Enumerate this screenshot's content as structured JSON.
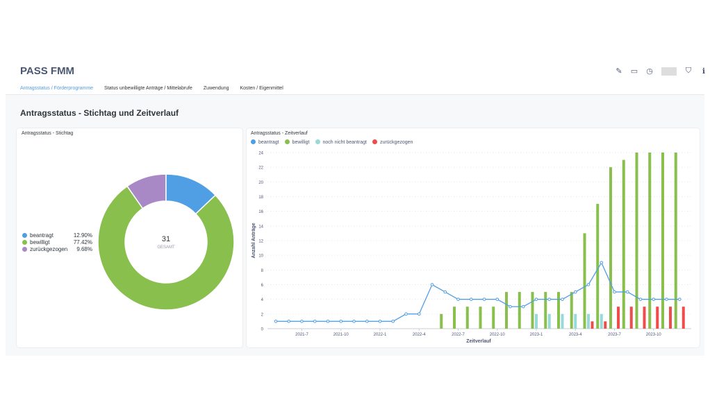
{
  "header": {
    "title": "PASS FMM",
    "icons": [
      "pencil-icon",
      "archive-icon",
      "clock-icon",
      "bookmark-icon",
      "info-icon",
      "more-icon"
    ]
  },
  "tabs": [
    {
      "label": "Antragsstatus / Förderprogramme",
      "active": true
    },
    {
      "label": "Status unbewilligte Anträge / Mittelabrufe"
    },
    {
      "label": "Zuwendung"
    },
    {
      "label": "Kosten / Eigenmittel"
    }
  ],
  "section_title": "Antragsstatus - Stichtag und Zeitverlauf",
  "colors": {
    "beantragt": "#509ee3",
    "bewilligt": "#88bf4d",
    "noch nicht beantragt": "#98d9d9",
    "zurückgezogen": "#ef4c4c",
    "zurückgezogen_pie": "#a989c5"
  },
  "chart_data": [
    {
      "type": "pie",
      "title": "Antragsstatus - Stichtag",
      "center_value": "31",
      "center_label": "GESAMT",
      "slices": [
        {
          "name": "beantragt",
          "percent": "12.90%",
          "value": 12.9
        },
        {
          "name": "bewilligt",
          "percent": "77.42%",
          "value": 77.42
        },
        {
          "name": "zurückgezogen",
          "percent": "9.68%",
          "value": 9.68
        }
      ]
    },
    {
      "type": "bar",
      "title": "Antragsstatus - Zeitverlauf",
      "xlabel": "Zeitverlauf",
      "ylabel": "Anzahl Anträge",
      "ylim": [
        0,
        24
      ],
      "yticks": [
        "0",
        "2",
        "4",
        "6",
        "8",
        "10",
        "12",
        "14",
        "16",
        "18",
        "20",
        "22",
        "24"
      ],
      "xticks": [
        "2021-7",
        "2021-10",
        "2022-1",
        "2022-4",
        "2022-7",
        "2022-10",
        "2023-1",
        "2023-4",
        "2023-7",
        "2023-10"
      ],
      "x": [
        "2021-5",
        "2021-6",
        "2021-7",
        "2021-8",
        "2021-9",
        "2021-10",
        "2021-11",
        "2021-12",
        "2022-1",
        "2022-2",
        "2022-3",
        "2022-4",
        "2022-5",
        "2022-6",
        "2022-7",
        "2022-8",
        "2022-9",
        "2022-10",
        "2022-11",
        "2022-12",
        "2023-1",
        "2023-2",
        "2023-3",
        "2023-4",
        "2023-5",
        "2023-6",
        "2023-7",
        "2023-8",
        "2023-9",
        "2023-10",
        "2023-11",
        "2023-12"
      ],
      "series": [
        {
          "name": "beantragt",
          "type": "line",
          "values": [
            1,
            1,
            1,
            1,
            1,
            1,
            1,
            1,
            1,
            1,
            2,
            2,
            6,
            5,
            4,
            4,
            4,
            4,
            3,
            3,
            4,
            4,
            4,
            5,
            6,
            9,
            5,
            5,
            4,
            4,
            4,
            4
          ]
        },
        {
          "name": "bewilligt",
          "type": "bar",
          "values": [
            0,
            0,
            0,
            0,
            0,
            0,
            0,
            0,
            0,
            0,
            0,
            0,
            0,
            2,
            3,
            3,
            3,
            3,
            5,
            5,
            5,
            5,
            5,
            5,
            13,
            17,
            22,
            23,
            24,
            24,
            24,
            24
          ]
        },
        {
          "name": "noch nicht beantragt",
          "type": "bar",
          "values": [
            0,
            0,
            0,
            0,
            0,
            0,
            0,
            0,
            0,
            0,
            0,
            0,
            0,
            0,
            0,
            0,
            0,
            0,
            0,
            0,
            2,
            2,
            2,
            2,
            2,
            2,
            0,
            0,
            0,
            0,
            0,
            0
          ]
        },
        {
          "name": "zurückgezogen",
          "type": "bar",
          "values": [
            0,
            0,
            0,
            0,
            0,
            0,
            0,
            0,
            0,
            0,
            0,
            0,
            0,
            0,
            0,
            0,
            0,
            0,
            0,
            0,
            0,
            0,
            0,
            0,
            1,
            1,
            3,
            3,
            3,
            3,
            3,
            3
          ]
        }
      ]
    }
  ]
}
